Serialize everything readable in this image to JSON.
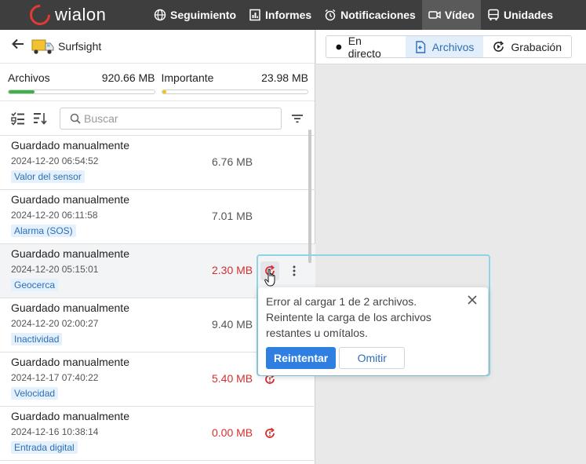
{
  "app": {
    "logo_text": "wialon"
  },
  "nav": [
    {
      "label": "Seguimiento",
      "icon": "globe-icon",
      "active": false
    },
    {
      "label": "Informes",
      "icon": "report-icon",
      "active": false
    },
    {
      "label": "Notificaciones",
      "icon": "alarm-clock-icon",
      "active": false
    },
    {
      "label": "Vídeo",
      "icon": "video-camera-icon",
      "active": true
    },
    {
      "label": "Unidades",
      "icon": "bus-icon",
      "active": false
    }
  ],
  "unit": {
    "name": "Surfsight"
  },
  "storage": {
    "files_label": "Archivos",
    "files_value": "920.66 MB",
    "files_fill": 0.18,
    "important_label": "Importante",
    "important_value": "23.98 MB",
    "important_fill": 0.03
  },
  "search": {
    "placeholder": "Buscar",
    "value": ""
  },
  "rows": [
    {
      "title": "Guardado manualmente",
      "date": "2024-12-20 06:54:52",
      "tag": "Valor del sensor",
      "size": "6.76 MB",
      "error": false
    },
    {
      "title": "Guardado manualmente",
      "date": "2024-12-20 06:11:58",
      "tag": "Alarma (SOS)",
      "size": "7.01 MB",
      "error": false
    },
    {
      "title": "Guardado manualmente",
      "date": "2024-12-20 05:15:01",
      "tag": "Geocerca",
      "size": "2.30 MB",
      "error": true
    },
    {
      "title": "Guardado manualmente",
      "date": "2024-12-20 02:00:27",
      "tag": "Inactividad",
      "size": "9.40 MB",
      "error": false
    },
    {
      "title": "Guardado manualmente",
      "date": "2024-12-17 07:40:22",
      "tag": "Velocidad",
      "size": "5.40 MB",
      "error": true
    },
    {
      "title": "Guardado manualmente",
      "date": "2024-12-16 10:38:14",
      "tag": "Entrada digital",
      "size": "0.00 MB",
      "error": true
    }
  ],
  "tabs": [
    {
      "label": "En directo",
      "icon": "dot-icon",
      "active": false
    },
    {
      "label": "Archivos",
      "icon": "file-icon",
      "active": true
    },
    {
      "label": "Grabación",
      "icon": "record-icon",
      "active": false
    }
  ],
  "popover": {
    "message": "Error al cargar 1 de 2 archivos. Reintente la carga de los archivos restantes u omítalos.",
    "retry_label": "Reintentar",
    "skip_label": "Omitir"
  },
  "colors": {
    "accent": "#2f7fe0",
    "files_bar": "#3cb34a",
    "important_bar": "#f4c20d",
    "error": "#d32f2f"
  }
}
